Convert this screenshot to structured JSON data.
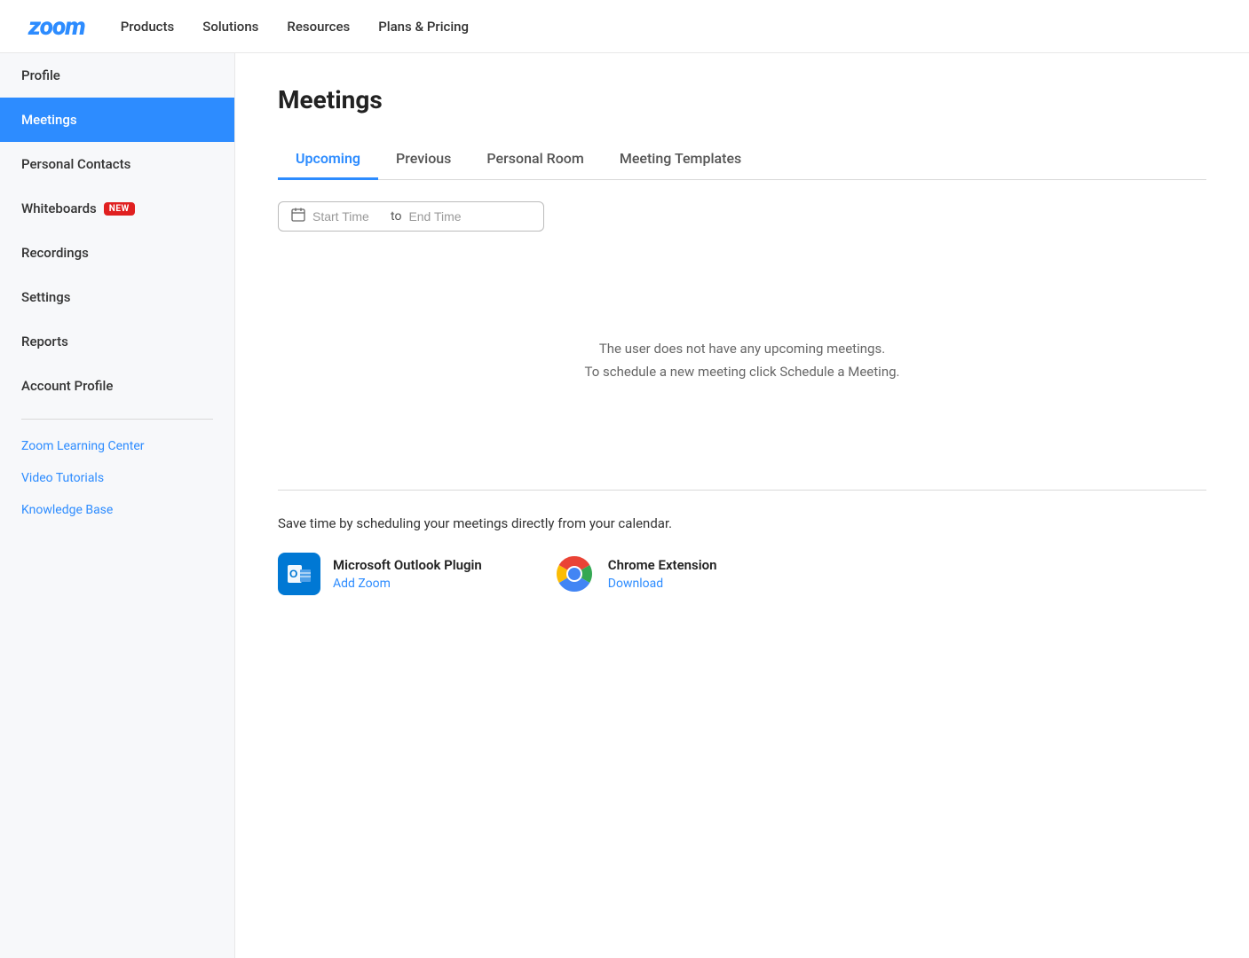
{
  "topnav": {
    "logo": "zoom",
    "links": [
      {
        "id": "products",
        "label": "Products"
      },
      {
        "id": "solutions",
        "label": "Solutions"
      },
      {
        "id": "resources",
        "label": "Resources"
      },
      {
        "id": "plans",
        "label": "Plans & Pricing"
      }
    ]
  },
  "sidebar": {
    "items": [
      {
        "id": "profile",
        "label": "Profile",
        "active": false,
        "badge": null
      },
      {
        "id": "meetings",
        "label": "Meetings",
        "active": true,
        "badge": null
      },
      {
        "id": "personal-contacts",
        "label": "Personal Contacts",
        "active": false,
        "badge": null
      },
      {
        "id": "whiteboards",
        "label": "Whiteboards",
        "active": false,
        "badge": "NEW"
      },
      {
        "id": "recordings",
        "label": "Recordings",
        "active": false,
        "badge": null
      },
      {
        "id": "settings",
        "label": "Settings",
        "active": false,
        "badge": null
      },
      {
        "id": "reports",
        "label": "Reports",
        "active": false,
        "badge": null
      },
      {
        "id": "account-profile",
        "label": "Account Profile",
        "active": false,
        "badge": null
      }
    ],
    "links": [
      {
        "id": "learning-center",
        "label": "Zoom Learning Center"
      },
      {
        "id": "video-tutorials",
        "label": "Video Tutorials"
      },
      {
        "id": "knowledge-base",
        "label": "Knowledge Base"
      }
    ]
  },
  "main": {
    "page_title": "Meetings",
    "tabs": [
      {
        "id": "upcoming",
        "label": "Upcoming",
        "active": true
      },
      {
        "id": "previous",
        "label": "Previous",
        "active": false
      },
      {
        "id": "personal-room",
        "label": "Personal Room",
        "active": false
      },
      {
        "id": "meeting-templates",
        "label": "Meeting Templates",
        "active": false
      }
    ],
    "date_range": {
      "start_placeholder": "Start Time",
      "end_placeholder": "End Time",
      "separator": "to"
    },
    "empty_state": {
      "line1": "The user does not have any upcoming meetings.",
      "line2": "To schedule a new meeting click Schedule a Meeting."
    },
    "footer": {
      "save_text": "Save time by scheduling your meetings directly from your calendar.",
      "plugins": [
        {
          "id": "outlook",
          "name": "Microsoft Outlook Plugin",
          "action_label": "Add Zoom"
        },
        {
          "id": "chrome",
          "name": "Chrome Extension",
          "action_label": "Download"
        }
      ]
    }
  }
}
